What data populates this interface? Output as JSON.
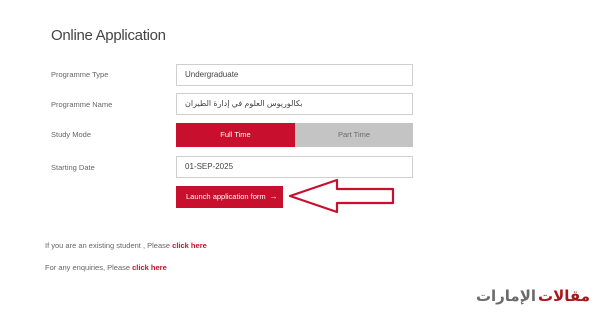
{
  "page": {
    "title": "Online Application"
  },
  "form": {
    "programme_type": {
      "label": "Programme Type",
      "value": "Undergraduate"
    },
    "programme_name": {
      "label": "Programme Name",
      "value": "بكالوريوس العلوم في إدارة الطيران"
    },
    "study_mode": {
      "label": "Study Mode",
      "options": [
        "Full Time",
        "Part Time"
      ],
      "selected": "Full Time"
    },
    "starting_date": {
      "label": "Starting Date",
      "value": "01-SEP-2025"
    },
    "launch_button": {
      "label": "Launch application form",
      "arrow": "→"
    }
  },
  "info": {
    "existing_student_text": "If you are an existing student , Please",
    "existing_student_link": "click here",
    "enquiries_text": "For any enquiries, Please",
    "enquiries_link": "click here"
  },
  "watermark": {
    "word1": "مقالات",
    "word2": "الإمارات"
  },
  "colors": {
    "accent": "#c8102e",
    "inactive": "#c4c4c4"
  }
}
